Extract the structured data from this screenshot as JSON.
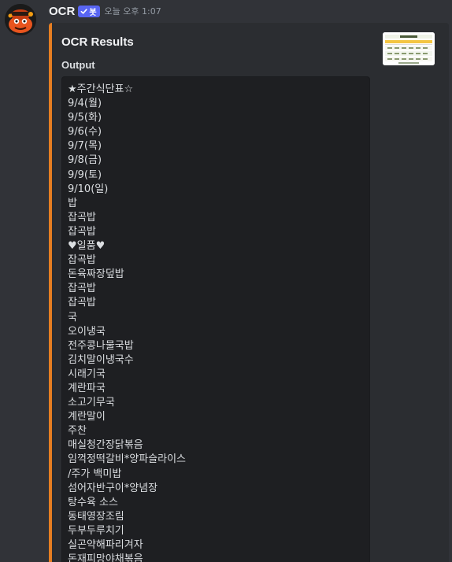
{
  "message": {
    "username": "OCR",
    "bot_tag": "봇",
    "timestamp": "오늘 오후 1:07"
  },
  "embed": {
    "title": "OCR Results",
    "field_name": "Output",
    "accent_color": "#e67e22",
    "output_lines": [
      "★주간식단표☆",
      "9/4(월)",
      "9/5(화)",
      "9/6(수)",
      "9/7(목)",
      "9/8(금)",
      "9/9(토)",
      "9/10(일)",
      "밥",
      "잡곡밥",
      "잡곡밥",
      "♥일품♥",
      "잡곡밥",
      "돈육짜장덮밥",
      "잡곡밥",
      "잡곡밥",
      "국",
      "오이냉국",
      "전주콩나물국밥",
      "김치말이냉국수",
      "시래기국",
      "계란파국",
      "소고기무국",
      "계란말이",
      "주찬",
      "매실청간장닭볶음",
      "임꺽정떡갈비*양파슬라이스",
      "/주가 백미밥",
      "섬어자반구이*양념장",
      "탕수육 소스",
      "동태영장조림",
      "두부두루치기",
      "실곤약해파리겨자",
      "돈재피망야채볶음"
    ]
  },
  "icons": {
    "avatar": "orange-cartoon-avatar-icon",
    "bot_check": "checkmark-icon",
    "thumbnail": "weekly-menu-image-thumbnail"
  }
}
